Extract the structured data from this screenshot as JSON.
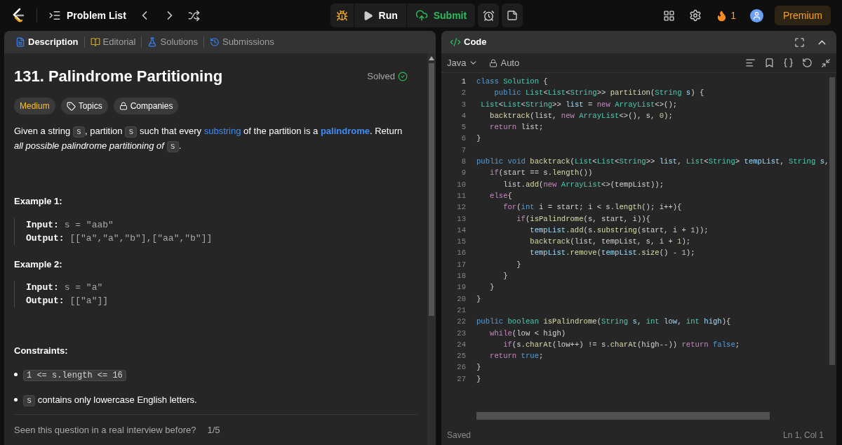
{
  "topbar": {
    "nav_title": "Problem List",
    "run": "Run",
    "submit": "Submit",
    "streak": "1",
    "premium": "Premium"
  },
  "description_tabs": [
    {
      "label": "Description",
      "selected": true
    },
    {
      "label": "Editorial",
      "selected": false
    },
    {
      "label": "Solutions",
      "selected": false
    },
    {
      "label": "Submissions",
      "selected": false
    }
  ],
  "problem": {
    "title": "131. Palindrome Partitioning",
    "status": "Solved",
    "difficulty": "Medium",
    "tags": [
      "Topics",
      "Companies"
    ],
    "statement": [
      {
        "kind": "text",
        "t": "Given a string "
      },
      {
        "kind": "code",
        "t": "s"
      },
      {
        "kind": "text",
        "t": ", partition "
      },
      {
        "kind": "code",
        "t": "s"
      },
      {
        "kind": "text",
        "t": " such that every "
      },
      {
        "kind": "link",
        "t": "substring"
      },
      {
        "kind": "text",
        "t": " of the partition is a "
      },
      {
        "kind": "strong-link",
        "t": "palindrome"
      },
      {
        "kind": "text",
        "t": ". Return "
      },
      {
        "kind": "italic",
        "t": "all possible palindrome partitioning of "
      },
      {
        "kind": "code",
        "t": "s"
      },
      {
        "kind": "text",
        "t": "."
      }
    ],
    "examples": [
      {
        "title": "Example 1:",
        "input_label": "Input:",
        "input": "s = \"aab\"",
        "output_label": "Output:",
        "output": "[[\"a\",\"a\",\"b\"],[\"aa\",\"b\"]]"
      },
      {
        "title": "Example 2:",
        "input_label": "Input:",
        "input": "s = \"a\"",
        "output_label": "Output:",
        "output": "[[\"a\"]]"
      }
    ],
    "constraints_title": "Constraints:",
    "constraints": [
      [
        {
          "kind": "code",
          "t": "1 <= s.length <= 16"
        }
      ],
      [
        {
          "kind": "code",
          "t": "s"
        },
        {
          "kind": "text",
          "t": " contains only lowercase English letters."
        }
      ]
    ],
    "footer": {
      "question": "Seen this question in a real interview before?",
      "count": "1/5"
    }
  },
  "code_panel": {
    "title": "Code",
    "language": "Java",
    "mode": "Auto",
    "status": "Saved",
    "cursor": "Ln 1, Col 1",
    "lines": [
      {
        "n": "1",
        "tokens": [
          {
            "kind": "kw",
            "t": "class "
          },
          {
            "kind": "type",
            "t": "Solution"
          },
          {
            "kind": "p",
            "t": " {"
          }
        ]
      },
      {
        "n": "2",
        "tokens": [
          {
            "kind": "kw",
            "t": "    public "
          },
          {
            "kind": "type",
            "t": "List"
          },
          {
            "kind": "p",
            "t": "<"
          },
          {
            "kind": "type",
            "t": "List"
          },
          {
            "kind": "p",
            "t": "<"
          },
          {
            "kind": "type",
            "t": "String"
          },
          {
            "kind": "p",
            "t": ">> "
          },
          {
            "kind": "fn",
            "t": "partition"
          },
          {
            "kind": "p",
            "t": "("
          },
          {
            "kind": "type",
            "t": "String "
          },
          {
            "kind": "var",
            "t": "s"
          },
          {
            "kind": "p",
            "t": ") {"
          }
        ]
      },
      {
        "n": "3",
        "tokens": [
          {
            "kind": "type",
            "t": " List"
          },
          {
            "kind": "p",
            "t": "<"
          },
          {
            "kind": "type",
            "t": "List"
          },
          {
            "kind": "p",
            "t": "<"
          },
          {
            "kind": "type",
            "t": "String"
          },
          {
            "kind": "p",
            "t": ">> "
          },
          {
            "kind": "var",
            "t": "list"
          },
          {
            "kind": "p",
            "t": " = "
          },
          {
            "kind": "ctl",
            "t": "new "
          },
          {
            "kind": "type",
            "t": "ArrayList"
          },
          {
            "kind": "p",
            "t": "<>();"
          }
        ]
      },
      {
        "n": "4",
        "tokens": [
          {
            "kind": "fn",
            "t": "   backtrack"
          },
          {
            "kind": "p",
            "t": "(list, "
          },
          {
            "kind": "ctl",
            "t": "new "
          },
          {
            "kind": "type",
            "t": "ArrayList"
          },
          {
            "kind": "p",
            "t": "<>(), s, "
          },
          {
            "kind": "num",
            "t": "0"
          },
          {
            "kind": "p",
            "t": ");"
          }
        ]
      },
      {
        "n": "5",
        "tokens": [
          {
            "kind": "ctl",
            "t": "   return"
          },
          {
            "kind": "p",
            "t": " list;"
          }
        ]
      },
      {
        "n": "6",
        "tokens": [
          {
            "kind": "p",
            "t": "}"
          }
        ]
      },
      {
        "n": "7"
      },
      {
        "n": "8",
        "tokens": [
          {
            "kind": "kw",
            "t": "public void "
          },
          {
            "kind": "fn",
            "t": "backtrack"
          },
          {
            "kind": "p",
            "t": "("
          },
          {
            "kind": "type",
            "t": "List"
          },
          {
            "kind": "p",
            "t": "<"
          },
          {
            "kind": "type",
            "t": "List"
          },
          {
            "kind": "p",
            "t": "<"
          },
          {
            "kind": "type",
            "t": "String"
          },
          {
            "kind": "p",
            "t": ">> "
          },
          {
            "kind": "var",
            "t": "list"
          },
          {
            "kind": "p",
            "t": ", "
          },
          {
            "kind": "type",
            "t": "List"
          },
          {
            "kind": "p",
            "t": "<"
          },
          {
            "kind": "type",
            "t": "String"
          },
          {
            "kind": "p",
            "t": "> "
          },
          {
            "kind": "var",
            "t": "tempList"
          },
          {
            "kind": "p",
            "t": ", "
          },
          {
            "kind": "type",
            "t": "String "
          },
          {
            "kind": "var",
            "t": "s"
          },
          {
            "kind": "p",
            "t": ","
          }
        ]
      },
      {
        "n": "9",
        "tokens": [
          {
            "kind": "ctl",
            "t": "   if"
          },
          {
            "kind": "p",
            "t": "(start == s."
          },
          {
            "kind": "fn",
            "t": "length"
          },
          {
            "kind": "p",
            "t": "())"
          }
        ]
      },
      {
        "n": "10",
        "tokens": [
          {
            "kind": "p",
            "t": "      list."
          },
          {
            "kind": "fn",
            "t": "add"
          },
          {
            "kind": "p",
            "t": "("
          },
          {
            "kind": "ctl",
            "t": "new "
          },
          {
            "kind": "type",
            "t": "ArrayList"
          },
          {
            "kind": "p",
            "t": "<>(tempList));"
          }
        ]
      },
      {
        "n": "11",
        "tokens": [
          {
            "kind": "ctl",
            "t": "   else"
          },
          {
            "kind": "p",
            "t": "{"
          }
        ]
      },
      {
        "n": "12",
        "tokens": [
          {
            "kind": "ctl",
            "t": "      for"
          },
          {
            "kind": "p",
            "t": "("
          },
          {
            "kind": "kw",
            "t": "int"
          },
          {
            "kind": "p",
            "t": " i = start; i < s."
          },
          {
            "kind": "fn",
            "t": "length"
          },
          {
            "kind": "p",
            "t": "(); i++){"
          }
        ]
      },
      {
        "n": "13",
        "tokens": [
          {
            "kind": "ctl",
            "t": "         if"
          },
          {
            "kind": "p",
            "t": "("
          },
          {
            "kind": "fn",
            "t": "isPalindrome"
          },
          {
            "kind": "p",
            "t": "(s, start, i)){"
          }
        ]
      },
      {
        "n": "14",
        "tokens": [
          {
            "kind": "var",
            "t": "            tempList"
          },
          {
            "kind": "p",
            "t": "."
          },
          {
            "kind": "fn",
            "t": "add"
          },
          {
            "kind": "p",
            "t": "(s."
          },
          {
            "kind": "fn",
            "t": "substring"
          },
          {
            "kind": "p",
            "t": "(start, i + "
          },
          {
            "kind": "num",
            "t": "1"
          },
          {
            "kind": "p",
            "t": "));"
          }
        ]
      },
      {
        "n": "15",
        "tokens": [
          {
            "kind": "fn",
            "t": "            backtrack"
          },
          {
            "kind": "p",
            "t": "(list, tempList, s, i + "
          },
          {
            "kind": "num",
            "t": "1"
          },
          {
            "kind": "p",
            "t": ");"
          }
        ]
      },
      {
        "n": "16",
        "tokens": [
          {
            "kind": "var",
            "t": "            tempList"
          },
          {
            "kind": "p",
            "t": "."
          },
          {
            "kind": "fn",
            "t": "remove"
          },
          {
            "kind": "p",
            "t": "("
          },
          {
            "kind": "var",
            "t": "tempList"
          },
          {
            "kind": "p",
            "t": "."
          },
          {
            "kind": "fn",
            "t": "size"
          },
          {
            "kind": "p",
            "t": "() - "
          },
          {
            "kind": "num",
            "t": "1"
          },
          {
            "kind": "p",
            "t": ");"
          }
        ]
      },
      {
        "n": "17",
        "tokens": [
          {
            "kind": "p",
            "t": "         }"
          }
        ]
      },
      {
        "n": "18",
        "tokens": [
          {
            "kind": "p",
            "t": "      }"
          }
        ]
      },
      {
        "n": "19",
        "tokens": [
          {
            "kind": "p",
            "t": "   }"
          }
        ]
      },
      {
        "n": "20",
        "tokens": [
          {
            "kind": "p",
            "t": "}"
          }
        ]
      },
      {
        "n": "21"
      },
      {
        "n": "22",
        "tokens": [
          {
            "kind": "kw",
            "t": "public "
          },
          {
            "kind": "type",
            "t": "boolean "
          },
          {
            "kind": "fn",
            "t": "isPalindrome"
          },
          {
            "kind": "p",
            "t": "("
          },
          {
            "kind": "type",
            "t": "String "
          },
          {
            "kind": "var",
            "t": "s"
          },
          {
            "kind": "p",
            "t": ", "
          },
          {
            "kind": "type",
            "t": "int "
          },
          {
            "kind": "var",
            "t": "low"
          },
          {
            "kind": "p",
            "t": ", "
          },
          {
            "kind": "type",
            "t": "int "
          },
          {
            "kind": "var",
            "t": "high"
          },
          {
            "kind": "p",
            "t": "){"
          }
        ]
      },
      {
        "n": "23",
        "tokens": [
          {
            "kind": "ctl",
            "t": "   while"
          },
          {
            "kind": "p",
            "t": "(low < high)"
          }
        ]
      },
      {
        "n": "24",
        "tokens": [
          {
            "kind": "ctl",
            "t": "      if"
          },
          {
            "kind": "p",
            "t": "(s."
          },
          {
            "kind": "fn",
            "t": "charAt"
          },
          {
            "kind": "p",
            "t": "(low++) != s."
          },
          {
            "kind": "fn",
            "t": "charAt"
          },
          {
            "kind": "p",
            "t": "(high--)) "
          },
          {
            "kind": "ctl",
            "t": "return "
          },
          {
            "kind": "kw",
            "t": "false"
          },
          {
            "kind": "p",
            "t": ";"
          }
        ]
      },
      {
        "n": "25",
        "tokens": [
          {
            "kind": "ctl",
            "t": "   return "
          },
          {
            "kind": "kw",
            "t": "true"
          },
          {
            "kind": "p",
            "t": ";"
          }
        ]
      },
      {
        "n": "26",
        "tokens": [
          {
            "kind": "p",
            "t": "}"
          }
        ]
      },
      {
        "n": "27",
        "tokens": [
          {
            "kind": "p",
            "t": "}"
          }
        ]
      }
    ]
  }
}
